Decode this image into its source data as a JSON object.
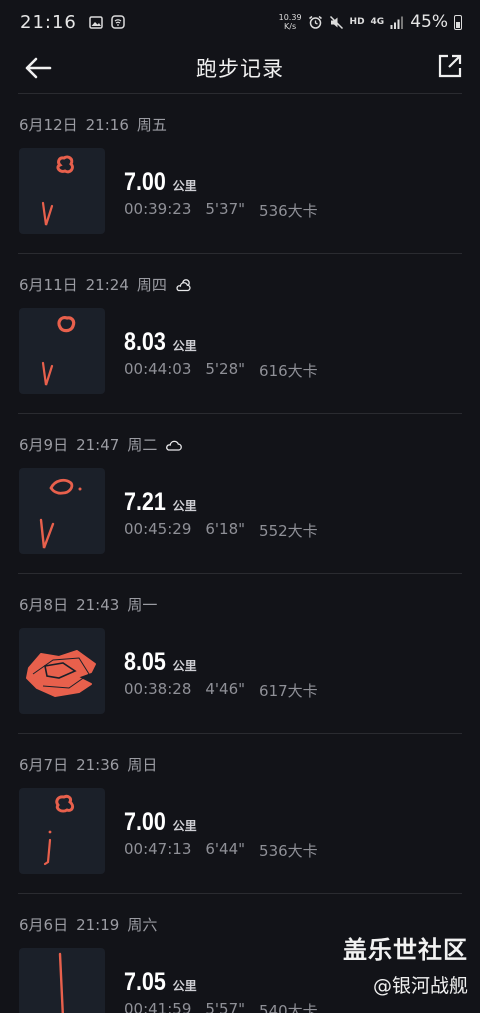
{
  "status_bar": {
    "time": "21:16",
    "net_speed_value": "10.39",
    "net_speed_unit": "K/s",
    "hd_label": "HD",
    "signal_label": "4G",
    "battery_percent": "45%",
    "battery_level": 0.45
  },
  "header": {
    "title": "跑步记录"
  },
  "records": [
    {
      "date": "6月12日",
      "time": "21:16",
      "weekday": "周五",
      "weather": "",
      "distance": "7.00",
      "unit": "公里",
      "duration": "00:39:23",
      "pace": "5'37\"",
      "calories": "536大卡"
    },
    {
      "date": "6月11日",
      "time": "21:24",
      "weekday": "周四",
      "weather": "partly-cloudy-icon",
      "distance": "8.03",
      "unit": "公里",
      "duration": "00:44:03",
      "pace": "5'28\"",
      "calories": "616大卡"
    },
    {
      "date": "6月9日",
      "time": "21:47",
      "weekday": "周二",
      "weather": "cloud-icon",
      "distance": "7.21",
      "unit": "公里",
      "duration": "00:45:29",
      "pace": "6'18\"",
      "calories": "552大卡"
    },
    {
      "date": "6月8日",
      "time": "21:43",
      "weekday": "周一",
      "weather": "",
      "distance": "8.05",
      "unit": "公里",
      "duration": "00:38:28",
      "pace": "4'46\"",
      "calories": "617大卡"
    },
    {
      "date": "6月7日",
      "time": "21:36",
      "weekday": "周日",
      "weather": "",
      "distance": "7.00",
      "unit": "公里",
      "duration": "00:47:13",
      "pace": "6'44\"",
      "calories": "536大卡"
    },
    {
      "date": "6月6日",
      "time": "21:19",
      "weekday": "周六",
      "weather": "",
      "distance": "7.05",
      "unit": "公里",
      "duration": "00:41:59",
      "pace": "5'57\"",
      "calories": "540大卡"
    }
  ],
  "watermark": {
    "line1": "盖乐世社区",
    "line2": "@银河战舰"
  },
  "colors": {
    "background": "#121318",
    "route": "#e8604c",
    "thumb_bg": "#1b2029"
  }
}
